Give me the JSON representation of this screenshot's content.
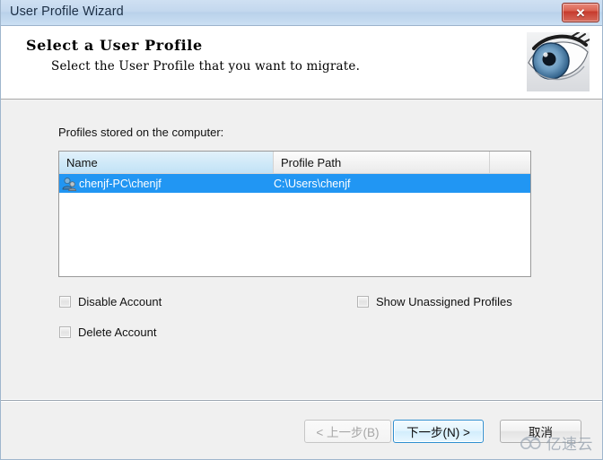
{
  "window": {
    "title": "User Profile Wizard",
    "close_label": "✕"
  },
  "header": {
    "title": "Select a User Profile",
    "subtitle": "Select the User Profile that you want to migrate.",
    "image_name": "eye-graphic"
  },
  "main": {
    "list_label": "Profiles stored on the computer:",
    "columns": [
      {
        "label": "Name",
        "sorted": true
      },
      {
        "label": "Profile Path",
        "sorted": false
      },
      {
        "label": "",
        "sorted": false
      }
    ],
    "rows": [
      {
        "icon": "user-account-icon",
        "name": "chenjf-PC\\chenjf",
        "path": "C:\\Users\\chenjf",
        "selected": true
      }
    ],
    "checkboxes": [
      {
        "id": "disable",
        "label": "Disable Account",
        "checked": false
      },
      {
        "id": "delete",
        "label": "Delete Account",
        "checked": false
      },
      {
        "id": "unassigned",
        "label": "Show Unassigned Profiles",
        "checked": false
      }
    ]
  },
  "footer": {
    "back_label": "< 上一步(B)",
    "back_disabled": true,
    "next_label": "下一步(N) >",
    "next_focused": true,
    "cancel_label": "取消"
  },
  "watermark": {
    "text": "亿速云"
  },
  "colors": {
    "titlebar": "#c3d8ee",
    "close_red": "#c6392c",
    "selection_blue": "#2196f3",
    "sorted_header": "#cfe9f8",
    "focus_border": "#2f8fd0",
    "body_gray": "#f0f0f0"
  }
}
